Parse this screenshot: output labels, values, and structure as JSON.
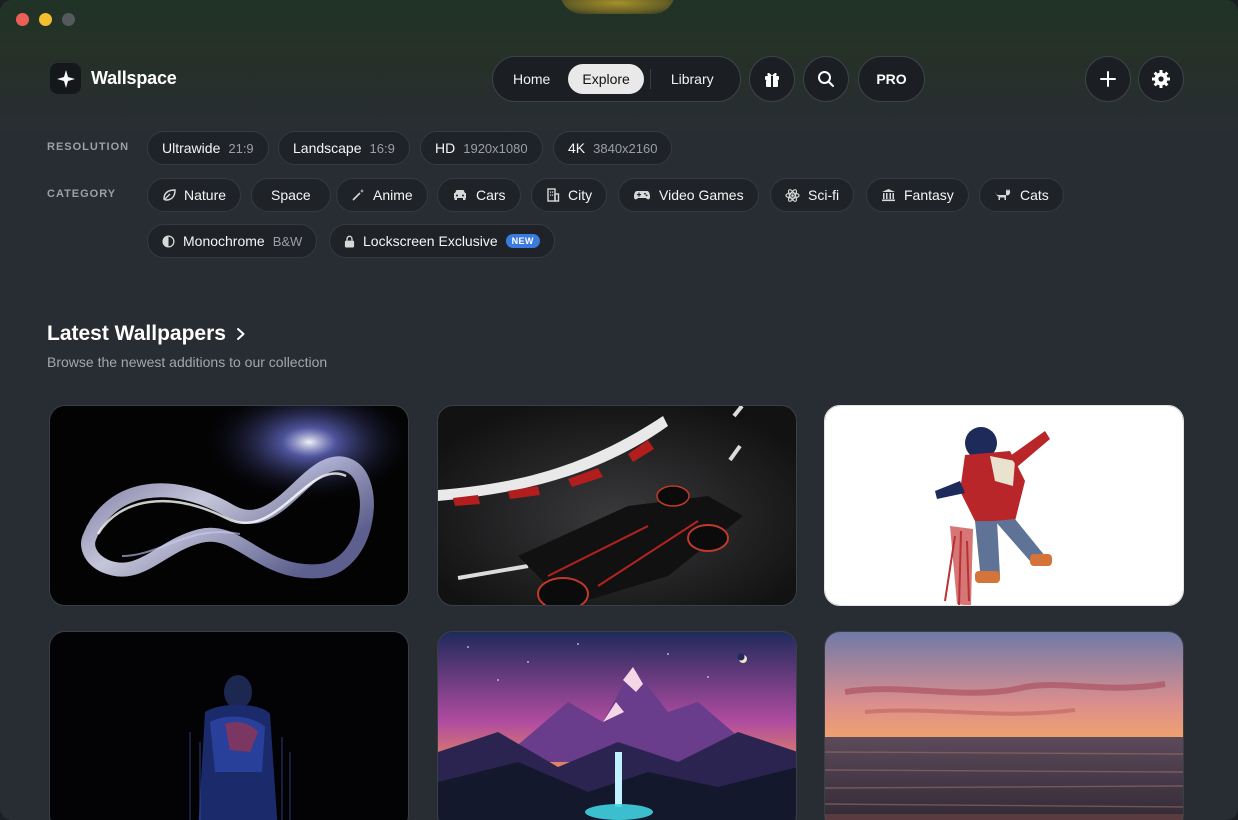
{
  "app": {
    "name": "Wallspace"
  },
  "nav": {
    "home": "Home",
    "explore": "Explore",
    "library": "Library",
    "pro": "PRO"
  },
  "filters": {
    "resolution_label": "RESOLUTION",
    "resolutions": [
      {
        "name": "Ultrawide",
        "detail": "21:9"
      },
      {
        "name": "Landscape",
        "detail": "16:9"
      },
      {
        "name": "HD",
        "detail": "1920x1080"
      },
      {
        "name": "4K",
        "detail": "3840x2160"
      }
    ],
    "category_label": "CATEGORY",
    "categories": [
      {
        "name": "Nature",
        "icon": "leaf-icon"
      },
      {
        "name": "Space",
        "icon": "none"
      },
      {
        "name": "Anime",
        "icon": "magic-wand-icon"
      },
      {
        "name": "Cars",
        "icon": "car-icon"
      },
      {
        "name": "City",
        "icon": "building-icon"
      },
      {
        "name": "Video Games",
        "icon": "gamepad-icon"
      },
      {
        "name": "Sci-fi",
        "icon": "atom-icon"
      },
      {
        "name": "Fantasy",
        "icon": "landmark-icon"
      },
      {
        "name": "Cats",
        "icon": "cat-icon"
      },
      {
        "name": "Monochrome",
        "detail": "B&W",
        "icon": "half-circle-icon"
      },
      {
        "name": "Lockscreen Exclusive",
        "badge": "NEW",
        "icon": "lock-icon"
      }
    ]
  },
  "section": {
    "title": "Latest Wallpapers",
    "subtitle": "Browse the newest additions to our collection"
  },
  "wallpapers": [
    {
      "subject": "glass ribbon loop"
    },
    {
      "subject": "formula race car"
    },
    {
      "subject": "hooded hero character"
    },
    {
      "subject": "figure in dark"
    },
    {
      "subject": "mountain waterfall sunset"
    },
    {
      "subject": "ocean sunset"
    }
  ],
  "colors": {
    "accent_badge": "#3b7be0",
    "active_nav": "#e9e9ea"
  }
}
